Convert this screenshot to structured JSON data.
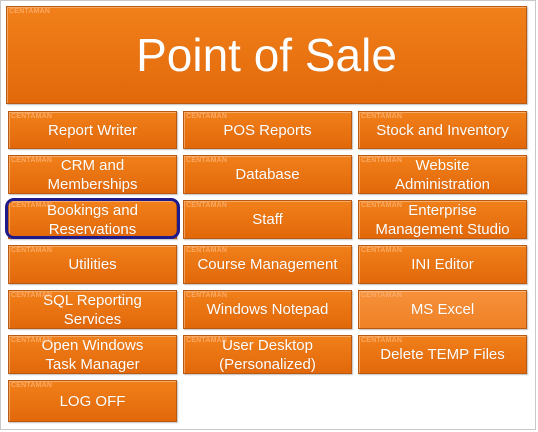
{
  "app": {
    "brand": "CENTAMAN",
    "title": "Point of Sale",
    "selected_item": "Bookings and Reservations"
  },
  "menu": {
    "report_writer": "Report Writer",
    "pos_reports": "POS Reports",
    "stock_inventory": "Stock and Inventory",
    "crm": "CRM and\nMemberships",
    "database": "Database",
    "website_admin": "Website\nAdministration",
    "bookings": "Bookings and\nReservations",
    "staff": "Staff",
    "enterprise": "Enterprise\nManagement Studio",
    "utilities": "Utilities",
    "course_mgmt": "Course Management",
    "ini_editor": "INI Editor",
    "sql_reporting": "SQL Reporting\nServices",
    "notepad": "Windows Notepad",
    "ms_excel": "MS Excel",
    "task_manager": "Open Windows\nTask Manager",
    "user_desktop": "User Desktop\n(Personalized)",
    "delete_temp": "Delete TEMP Files",
    "log_off": "LOG OFF"
  },
  "colors": {
    "tile": "#e8700e",
    "tile_light": "#f28a30",
    "text": "#ffffff",
    "selection_outline": "#1f1a8c"
  }
}
